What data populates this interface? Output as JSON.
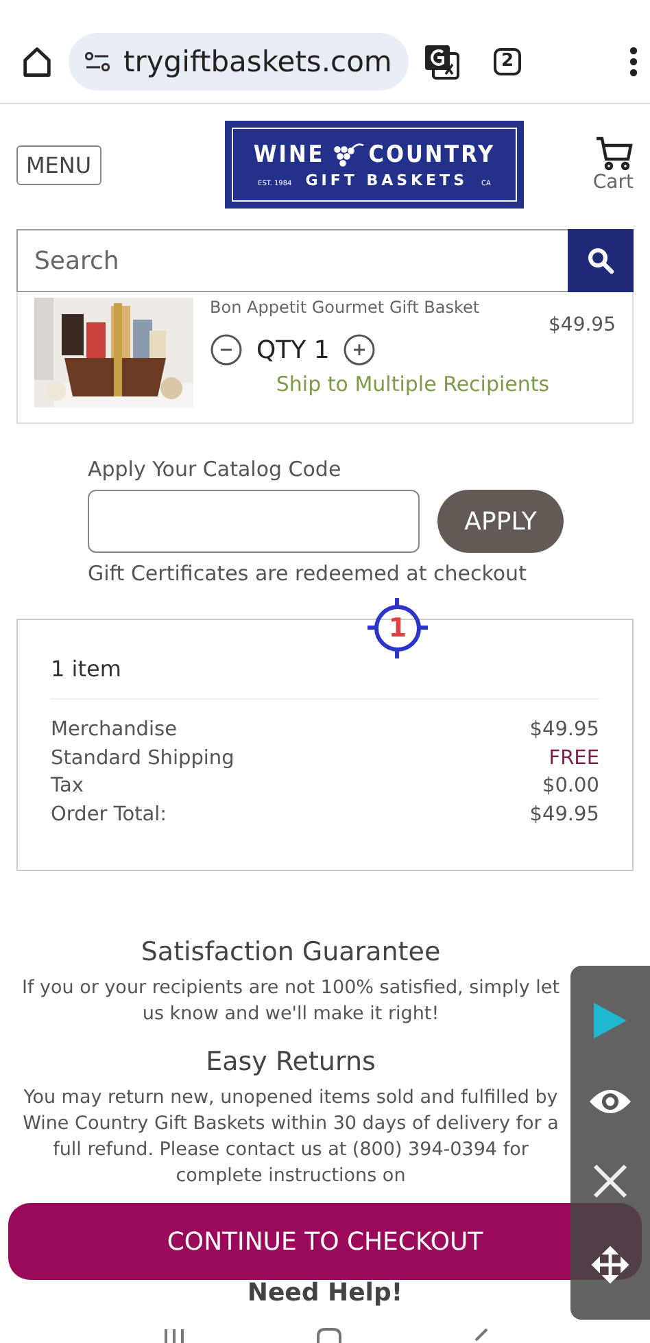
{
  "browser": {
    "url": "trygiftbaskets.com",
    "tab_count": "2"
  },
  "header": {
    "menu": "MENU",
    "logo": {
      "word1": "WINE",
      "word2": "COUNTRY",
      "tagline": "GIFT BASKETS",
      "est": "EST. 1984",
      "region": "CA"
    },
    "cart": "Cart"
  },
  "search": {
    "placeholder": "Search"
  },
  "cart_item": {
    "title": "Bon Appetit Gourmet Gift Basket",
    "price": "$49.95",
    "qty": "QTY 1",
    "ship_link": "Ship to Multiple Recipients"
  },
  "catalog": {
    "label": "Apply Your Catalog Code",
    "button": "APPLY",
    "note": "Gift Certificates are redeemed at checkout"
  },
  "marker": "1",
  "summary": {
    "count": "1 item",
    "rows": [
      {
        "label": "Merchandise",
        "value": "$49.95",
        "kind": "plain"
      },
      {
        "label": "Standard Shipping",
        "value": "FREE",
        "kind": "free"
      },
      {
        "label": "Tax",
        "value": "$0.00",
        "kind": "plain"
      },
      {
        "label": "Order Total:",
        "value": "$49.95",
        "kind": "plain"
      }
    ]
  },
  "guarantee": {
    "title": "Satisfaction Guarantee",
    "text": "If you or your recipients are not 100% satisfied, simply let us know and we'll make it right!"
  },
  "returns": {
    "title": "Easy Returns",
    "text": "You may return new, unopened items sold and fulfilled by Wine Country Gift Baskets within 30 days of delivery for a full refund. Please contact us at (800) 394-0394 for complete instructions on"
  },
  "checkout": "CONTINUE TO CHECKOUT",
  "need_help": "Need Help!"
}
